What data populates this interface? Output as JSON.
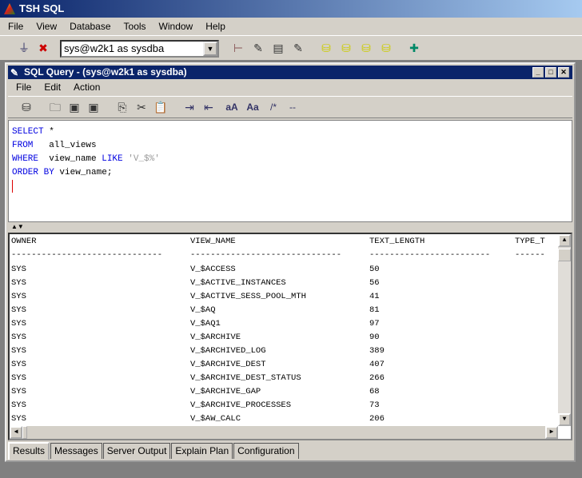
{
  "app": {
    "title": "TSH SQL",
    "menu": [
      "File",
      "View",
      "Database",
      "Tools",
      "Window",
      "Help"
    ],
    "connection": "sys@w2k1 as sysdba"
  },
  "window": {
    "title": "SQL Query - (sys@w2k1 as sysdba)",
    "menu": [
      "File",
      "Edit",
      "Action"
    ],
    "toolbar_text": [
      "aA",
      "Aa",
      "/*",
      "--"
    ]
  },
  "editor": {
    "lines": [
      {
        "kw": "SELECT",
        "rest": " *"
      },
      {
        "kw": "FROM",
        "rest": "   all_views"
      },
      {
        "kw": "WHERE",
        "rest": "  view_name ",
        "kw2": "LIKE",
        "str": " 'V_$%'"
      },
      {
        "kw": "ORDER BY",
        "rest": " view_name;"
      }
    ]
  },
  "results": {
    "columns": [
      "OWNER",
      "VIEW_NAME",
      "TEXT_LENGTH",
      "TYPE_T"
    ],
    "dashes": [
      "------------------------------",
      "------------------------------",
      "------------------------",
      "------"
    ],
    "rows": [
      [
        "SYS",
        "V_$ACCESS",
        "50"
      ],
      [
        "SYS",
        "V_$ACTIVE_INSTANCES",
        "56"
      ],
      [
        "SYS",
        "V_$ACTIVE_SESS_POOL_MTH",
        "41"
      ],
      [
        "SYS",
        "V_$AQ",
        "81"
      ],
      [
        "SYS",
        "V_$AQ1",
        "97"
      ],
      [
        "SYS",
        "V_$ARCHIVE",
        "90"
      ],
      [
        "SYS",
        "V_$ARCHIVED_LOG",
        "389"
      ],
      [
        "SYS",
        "V_$ARCHIVE_DEST",
        "407"
      ],
      [
        "SYS",
        "V_$ARCHIVE_DEST_STATUS",
        "266"
      ],
      [
        "SYS",
        "V_$ARCHIVE_GAP",
        "68"
      ],
      [
        "SYS",
        "V_$ARCHIVE_PROCESSES",
        "73"
      ],
      [
        "SYS",
        "V_$AW_CALC",
        "206"
      ]
    ]
  },
  "tabs": [
    "Results",
    "Messages",
    "Server Output",
    "Explain Plan",
    "Configuration"
  ],
  "active_tab": "Results"
}
